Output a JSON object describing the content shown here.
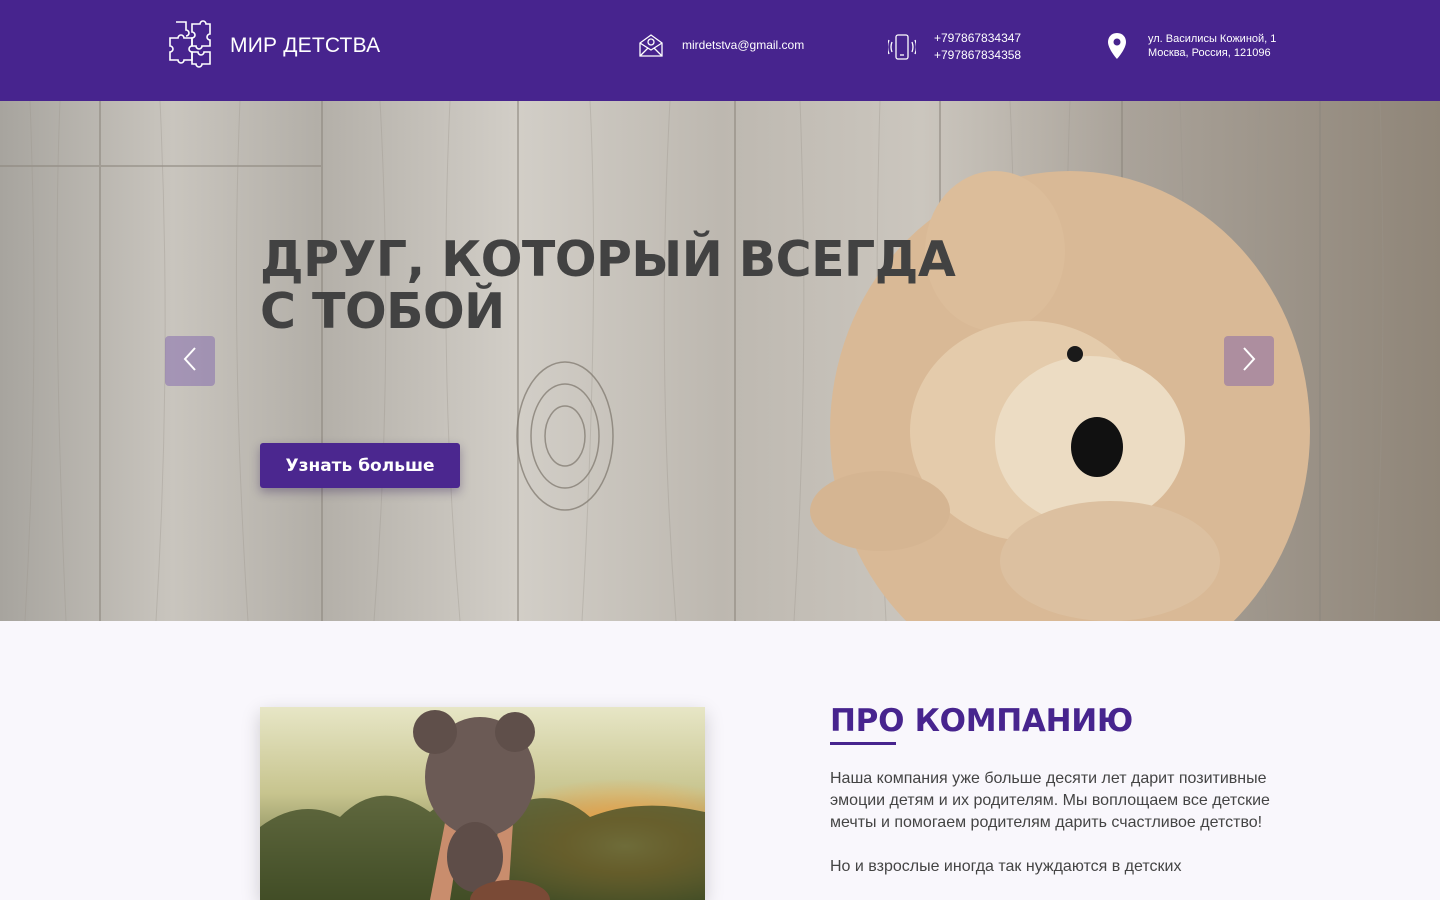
{
  "header": {
    "logo_text": "МИР ДЕТСТВА",
    "email": "mirdetstva@gmail.com",
    "phones": [
      "+797867834347",
      "+797867834358"
    ],
    "address_line1": "ул. Василисы Кожиной, 1",
    "address_line2": "Москва, Россия, 121096",
    "icons": [
      "puzzle-logo-icon",
      "envelope-icon",
      "phone-icon",
      "location-pin-icon"
    ]
  },
  "hero": {
    "title": "ДРУГ, КОТОРЫЙ ВСЕГДА С ТОБОЙ",
    "button_label": "Узнать больше",
    "prev_icon": "chevron-left-icon",
    "next_icon": "chevron-right-icon"
  },
  "about": {
    "title": "ПРО КОМПАНИЮ",
    "paragraph1": "Наша компания уже больше десяти лет дарит позитивные эмоции детям и их родителям. Мы воплощаем все детские мечты и помогаем родителям дарить счастливое детство!",
    "paragraph2": "Но и взрослые иногда так нуждаются в детских"
  },
  "colors": {
    "brand": "#47248e",
    "button": "#4b278f",
    "hero_text": "#424242",
    "page_bg": "#f9f7fc"
  }
}
